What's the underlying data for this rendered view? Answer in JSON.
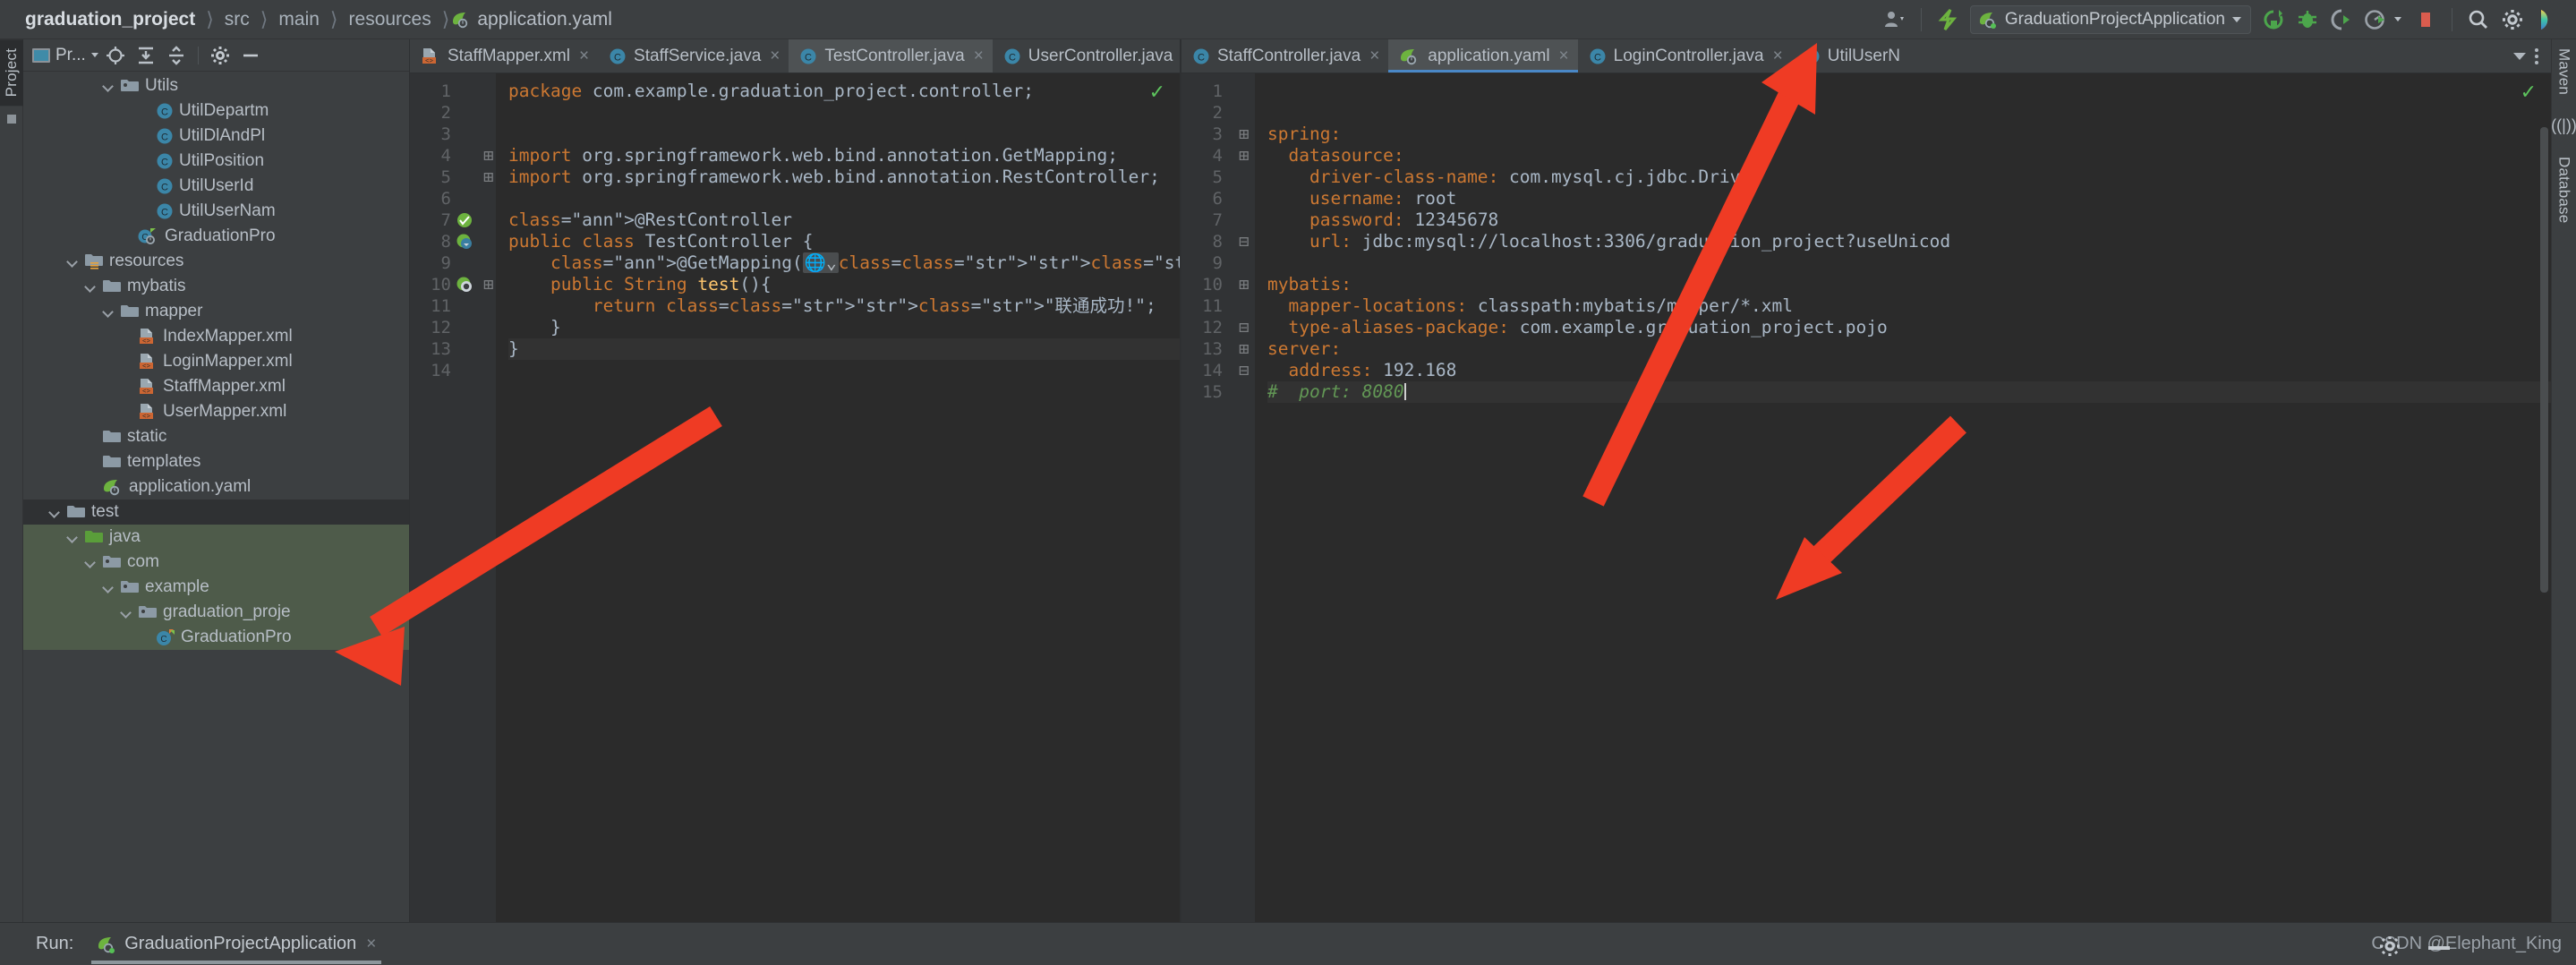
{
  "breadcrumb": {
    "items": [
      "graduation_project",
      "src",
      "main",
      "resources"
    ],
    "file": "application.yaml"
  },
  "toolbar": {
    "run_config": "GraduationProjectApplication",
    "icons": [
      "user-settings-icon",
      "updates-icon",
      "rerun-icon",
      "debug-icon",
      "coverage-icon",
      "profiler-icon",
      "stop-icon",
      "search-icon",
      "gear-icon",
      "ide-icon"
    ]
  },
  "left_strip": {
    "tab": "Project"
  },
  "right_strip": {
    "tabs": [
      "Maven",
      "Database"
    ]
  },
  "project_panel": {
    "title": "Pr...",
    "toolbar_icons": [
      "locate-icon",
      "expand-all-icon",
      "collapse-all-icon",
      "gear-icon",
      "hide-icon"
    ],
    "tree": [
      {
        "label": "Utils",
        "indent": 4,
        "icon": "package-folder-icon",
        "chevron": "open",
        "state": "none"
      },
      {
        "label": "UtilDepartm",
        "indent": 6,
        "icon": "java-class-icon",
        "chevron": "none",
        "state": "none"
      },
      {
        "label": "UtilDlAndPl",
        "indent": 6,
        "icon": "java-class-icon",
        "chevron": "none",
        "state": "none"
      },
      {
        "label": "UtilPosition",
        "indent": 6,
        "icon": "java-class-icon",
        "chevron": "none",
        "state": "none"
      },
      {
        "label": "UtilUserId",
        "indent": 6,
        "icon": "java-class-icon",
        "chevron": "none",
        "state": "none"
      },
      {
        "label": "UtilUserNam",
        "indent": 6,
        "icon": "java-class-icon",
        "chevron": "none",
        "state": "none"
      },
      {
        "label": "GraduationPro",
        "indent": 5,
        "icon": "spring-boot-class-icon",
        "chevron": "none",
        "state": "none"
      },
      {
        "label": "resources",
        "indent": 2,
        "icon": "resources-folder-icon",
        "chevron": "open",
        "state": "none"
      },
      {
        "label": "mybatis",
        "indent": 3,
        "icon": "folder-icon",
        "chevron": "open",
        "state": "none"
      },
      {
        "label": "mapper",
        "indent": 4,
        "icon": "folder-icon",
        "chevron": "open",
        "state": "none"
      },
      {
        "label": "IndexMapper.xml",
        "indent": 5,
        "icon": "xml-mapper-icon",
        "chevron": "none",
        "state": "none"
      },
      {
        "label": "LoginMapper.xml",
        "indent": 5,
        "icon": "xml-mapper-icon",
        "chevron": "none",
        "state": "none"
      },
      {
        "label": "StaffMapper.xml",
        "indent": 5,
        "icon": "xml-mapper-icon",
        "chevron": "none",
        "state": "none"
      },
      {
        "label": "UserMapper.xml",
        "indent": 5,
        "icon": "xml-mapper-icon",
        "chevron": "none",
        "state": "none"
      },
      {
        "label": "static",
        "indent": 3,
        "icon": "folder-icon",
        "chevron": "none",
        "state": "none"
      },
      {
        "label": "templates",
        "indent": 3,
        "icon": "folder-icon",
        "chevron": "none",
        "state": "none"
      },
      {
        "label": "application.yaml",
        "indent": 3,
        "icon": "spring-yaml-icon",
        "chevron": "none",
        "state": "none"
      },
      {
        "label": "test",
        "indent": 1,
        "icon": "folder-icon",
        "chevron": "open",
        "state": "selected-dark"
      },
      {
        "label": "java",
        "indent": 2,
        "icon": "test-source-folder-icon",
        "chevron": "open",
        "state": "selected-green"
      },
      {
        "label": "com",
        "indent": 3,
        "icon": "package-folder-icon",
        "chevron": "open",
        "state": "selected-green"
      },
      {
        "label": "example",
        "indent": 4,
        "icon": "package-folder-icon",
        "chevron": "open",
        "state": "selected-green"
      },
      {
        "label": "graduation_proje",
        "indent": 5,
        "icon": "package-folder-icon",
        "chevron": "open",
        "state": "selected-green"
      },
      {
        "label": "GraduationPro",
        "indent": 6,
        "icon": "java-test-class-icon",
        "chevron": "none",
        "state": "selected-green"
      }
    ]
  },
  "left_editor": {
    "tabs": [
      {
        "label": "StaffMapper.xml",
        "icon": "xml-mapper-icon",
        "active": false
      },
      {
        "label": "StaffService.java",
        "icon": "java-class-icon",
        "active": false
      },
      {
        "label": "TestController.java",
        "icon": "java-class-icon",
        "active": true
      },
      {
        "label": "UserController.java",
        "icon": "java-class-icon",
        "active": false
      }
    ],
    "line_numbers": [
      "1",
      "2",
      "3",
      "4",
      "5",
      "6",
      "7",
      "8",
      "9",
      "10",
      "11",
      "12",
      "13",
      "14"
    ],
    "lines": [
      "package com.example.graduation_project.controller;",
      "",
      "",
      "import org.springframework.web.bind.annotation.GetMapping;",
      "import org.springframework.web.bind.annotation.RestController;",
      "",
      "@RestController",
      "public class TestController {",
      "    @GetMapping(\"/\")",
      "    public String test(){",
      "        return \"联通成功!\";",
      "    }",
      "}",
      ""
    ],
    "valid_mark": "✓"
  },
  "right_editor": {
    "tabs": [
      {
        "label": "StaffController.java",
        "icon": "java-class-icon",
        "active": false
      },
      {
        "label": "application.yaml",
        "icon": "spring-yaml-icon",
        "active": true
      },
      {
        "label": "LoginController.java",
        "icon": "java-class-icon",
        "active": false
      },
      {
        "label": "UtilUserN",
        "icon": "java-class-icon",
        "active": false
      }
    ],
    "line_numbers": [
      "1",
      "2",
      "3",
      "4",
      "5",
      "6",
      "7",
      "8",
      "9",
      "10",
      "11",
      "12",
      "13",
      "14",
      "15"
    ],
    "lines": [
      "",
      "",
      "spring:",
      "  datasource:",
      "    driver-class-name: com.mysql.cj.jdbc.Driver",
      "    username: root",
      "    password: 12345678",
      "    url: jdbc:mysql://localhost:3306/graduation_project?useUnicod",
      "",
      "mybatis:",
      "  mapper-locations: classpath:mybatis/mapper/*.xml",
      "  type-aliases-package: com.example.graduation_project.pojo",
      "server:",
      "  address: 192.168",
      "#  port: 8080"
    ],
    "valid_mark": "✓"
  },
  "bottom": {
    "run_label": "Run:",
    "run_tab": "GraduationProjectApplication",
    "close_label": "×",
    "watermark": "CSDN @Elephant_King"
  },
  "colors": {
    "accent_blue": "#4a88c7",
    "spring_green": "#6db33f",
    "xml_orange": "#cc6633",
    "keyword_orange": "#cc7832",
    "string_green": "#6a8759",
    "annotation_yellow": "#bbb529",
    "arrow_red": "#ef3b24",
    "selection_green": "#4e5b4a"
  }
}
